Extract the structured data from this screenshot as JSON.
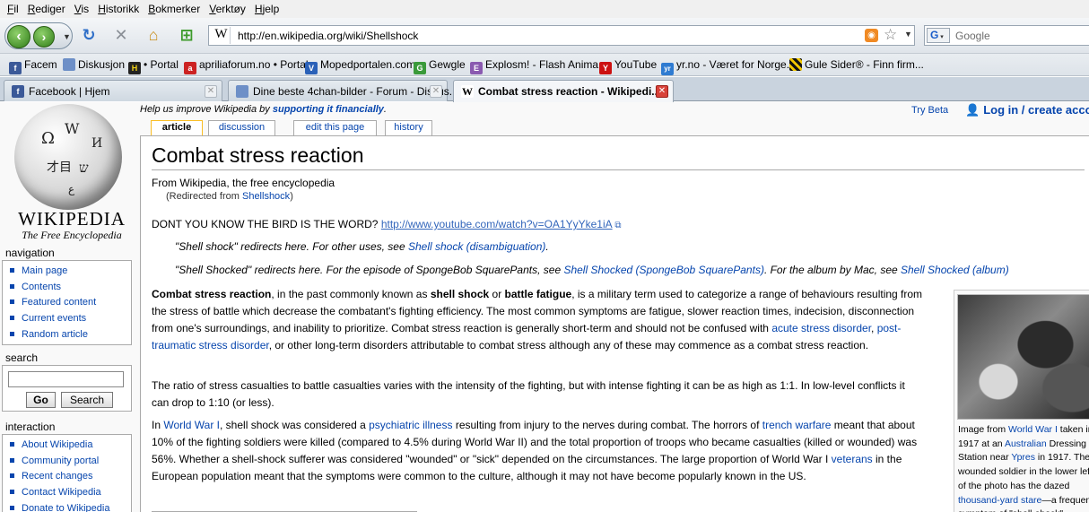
{
  "menu": [
    "Fil",
    "Rediger",
    "Vis",
    "Historikk",
    "Bokmerker",
    "Verktøy",
    "Hjelp"
  ],
  "toolbar": {
    "back_icon": "back-arrow-icon",
    "forward_icon": "forward-arrow-icon",
    "url": "http://en.wikipedia.org/wiki/Shellshock",
    "search_placeholder": "Google"
  },
  "bookmarks": [
    {
      "label": "Facem",
      "icon": "facebook-icon",
      "color": "#3b5998",
      "glyph": "f"
    },
    {
      "label": "Diskusjon",
      "icon": "page-icon",
      "color": "#6d8fc7",
      "glyph": ""
    },
    {
      "label": "• Portal",
      "icon": "portal-icon",
      "color": "#222222",
      "glyph": "H"
    },
    {
      "label": "apriliaforum.no • Portal",
      "icon": "aprilia-icon",
      "color": "#cc2222",
      "glyph": "a"
    },
    {
      "label": "Mopedportalen.com",
      "icon": "moped-icon",
      "color": "#2a61b8",
      "glyph": "V"
    },
    {
      "label": "Gewgle",
      "icon": "gewgle-icon",
      "color": "#3a9a3a",
      "glyph": "G"
    },
    {
      "label": "Explosm! - Flash Anima...",
      "icon": "explosm-icon",
      "color": "#8a5ab0",
      "glyph": "E"
    },
    {
      "label": "YouTube",
      "icon": "youtube-icon",
      "color": "#cc1111",
      "glyph": "Y"
    },
    {
      "label": "yr.no - Været for Norge...",
      "icon": "yr-icon",
      "color": "#2e7bd1",
      "glyph": "yr"
    },
    {
      "label": "Gule Sider® - Finn firm...",
      "icon": "gulesider-icon",
      "color": "#111111",
      "glyph": "G"
    }
  ],
  "tabs": [
    {
      "label": "Facebook | Hjem",
      "icon": "facebook-icon",
      "color": "#3b5998",
      "glyph": "f"
    },
    {
      "label": "Dine beste 4chan-bilder - Forum - Diskus...",
      "icon": "page-icon",
      "color": "#6d8fc7",
      "glyph": ""
    },
    {
      "label": "Combat stress reaction - Wikipedi...",
      "icon": "wikipedia-icon",
      "color": "#ffffff",
      "glyph": "W"
    }
  ],
  "wiki": {
    "wordmark": "WIKIPEDIA",
    "tagline": "The Free Encyclopedia",
    "sitenotice_pre": "Help us improve Wikipedia by ",
    "sitenotice_link": "supporting it financially",
    "sitenotice_post": ".",
    "try_beta": "Try Beta",
    "login": "Log in / create account",
    "page_tabs": [
      "article",
      "discussion",
      "edit this page",
      "history"
    ],
    "navigation_title": "navigation",
    "navigation": [
      "Main page",
      "Contents",
      "Featured content",
      "Current events",
      "Random article"
    ],
    "search_title": "search",
    "go_button": "Go",
    "search_button": "Search",
    "interaction_title": "interaction",
    "interaction": [
      "About Wikipedia",
      "Community portal",
      "Recent changes",
      "Contact Wikipedia",
      "Donate to Wikipedia"
    ]
  },
  "article": {
    "title": "Combat stress reaction",
    "site_sub": "From Wikipedia, the free encyclopedia",
    "redirect_pre": "(Redirected from ",
    "redirect_link": "Shellshock",
    "redirect_post": ")",
    "vandal_text": "DONT YOU KNOW THE BIRD IS THE WORD? ",
    "vandal_link": "http://www.youtube.com/watch?v=OA1YyYke1iA",
    "hat1_pre": "\"Shell shock\" redirects here. For other uses, see ",
    "hat1_link": "Shell shock (disambiguation)",
    "hat1_post": ".",
    "hat2_pre": "\"Shell Shocked\" redirects here. For the episode of SpongeBob SquarePants, see ",
    "hat2_link": "Shell Shocked (SpongeBob SquarePants)",
    "hat2_mid": ". For the album by Mac, see ",
    "hat2_link2": "Shell Shocked (album)",
    "p1": {
      "b1": "Combat stress reaction",
      "t1": ", in the past commonly known as ",
      "b2": "shell shock",
      "t2": " or ",
      "b3": "battle fatigue",
      "t3": ", is a military term used to categorize a range of behaviours resulting from the stress of battle which decrease the combatant's fighting efficiency. The most common symptoms are fatigue, slower reaction times, indecision, disconnection from one's surroundings, and inability to prioritize. Combat stress reaction is generally short-term and should not be confused with ",
      "l1": "acute stress disorder",
      "t4": ", ",
      "l2": "post-traumatic stress disorder",
      "t5": ", or other long-term disorders attributable to combat stress although any of these may commence as a combat stress reaction."
    },
    "p2": "The ratio of stress casualties to battle casualties varies with the intensity of the fighting, but with intense fighting it can be as high as 1:1. In low-level conflicts it can drop to 1:10 (or less).",
    "p3": {
      "t0": "In ",
      "l1": "World War I",
      "t1": ", shell shock was considered a ",
      "l2": "psychiatric illness",
      "t2": " resulting from injury to the nerves during combat. The horrors of ",
      "l3": "trench warfare",
      "t3": " meant that about 10% of the fighting soldiers were killed (compared to 4.5% during World War II) and the total proportion of troops who became casualties (killed or wounded) was 56%. Whether a shell-shock sufferer was considered \"wounded\" or \"sick\" depended on the circumstances. The large proportion of World War I ",
      "l4": "veterans",
      "t4": " in the European population meant that the symptoms were common to the culture, although it may not have become popularly known in the US."
    },
    "caption": {
      "t0": "Image from ",
      "l1": "World War I",
      "t1": " taken in 1917 at an ",
      "l2": "Australian",
      "t2": " Dressing Station near ",
      "l3": "Ypres",
      "t3": " in 1917. The wounded soldier in the lower left of the photo has the dazed ",
      "l4": "thousand-yard stare",
      "t4": "—a frequent symptom of \"shell-shock\"."
    }
  }
}
